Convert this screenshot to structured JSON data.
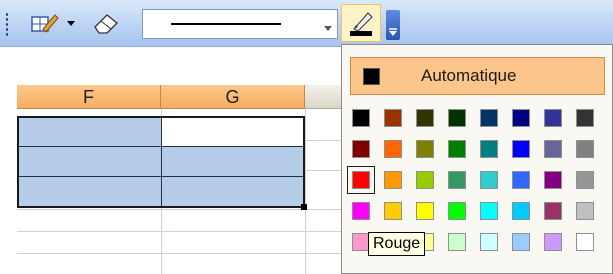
{
  "toolbar": {
    "icons": [
      "toolbar-grip",
      "border-draw-pen-icon",
      "dropdown-arrow-icon",
      "eraser-icon",
      "line-color-pen-icon",
      "toolbar-options-icon"
    ],
    "line_style_dropdown_icon": "chevron-down-icon"
  },
  "sheet": {
    "columns": [
      "F",
      "G",
      ""
    ],
    "selected_cell_color": "#b6cdea"
  },
  "palette": {
    "automatic_label": "Automatique",
    "automatic_color": "#000000",
    "hovered_color_name": "Rouge",
    "colors": [
      [
        "#000000",
        "#993300",
        "#333300",
        "#003300",
        "#003366",
        "#000080",
        "#333399",
        "#333333"
      ],
      [
        "#800000",
        "#ff6600",
        "#808000",
        "#008000",
        "#008080",
        "#0000ff",
        "#666699",
        "#808080"
      ],
      [
        "#ff0000",
        "#ff9900",
        "#99cc00",
        "#339966",
        "#33cccc",
        "#3366ff",
        "#800080",
        "#969696"
      ],
      [
        "#ff00ff",
        "#ffcc00",
        "#ffff00",
        "#00ff00",
        "#00ffff",
        "#00ccff",
        "#993366",
        "#c0c0c0"
      ],
      [
        "#ff99cc",
        "#ffcc99",
        "#ffff99",
        "#ccffcc",
        "#ccffff",
        "#99ccff",
        "#cc99ff",
        "#ffffff"
      ]
    ]
  }
}
